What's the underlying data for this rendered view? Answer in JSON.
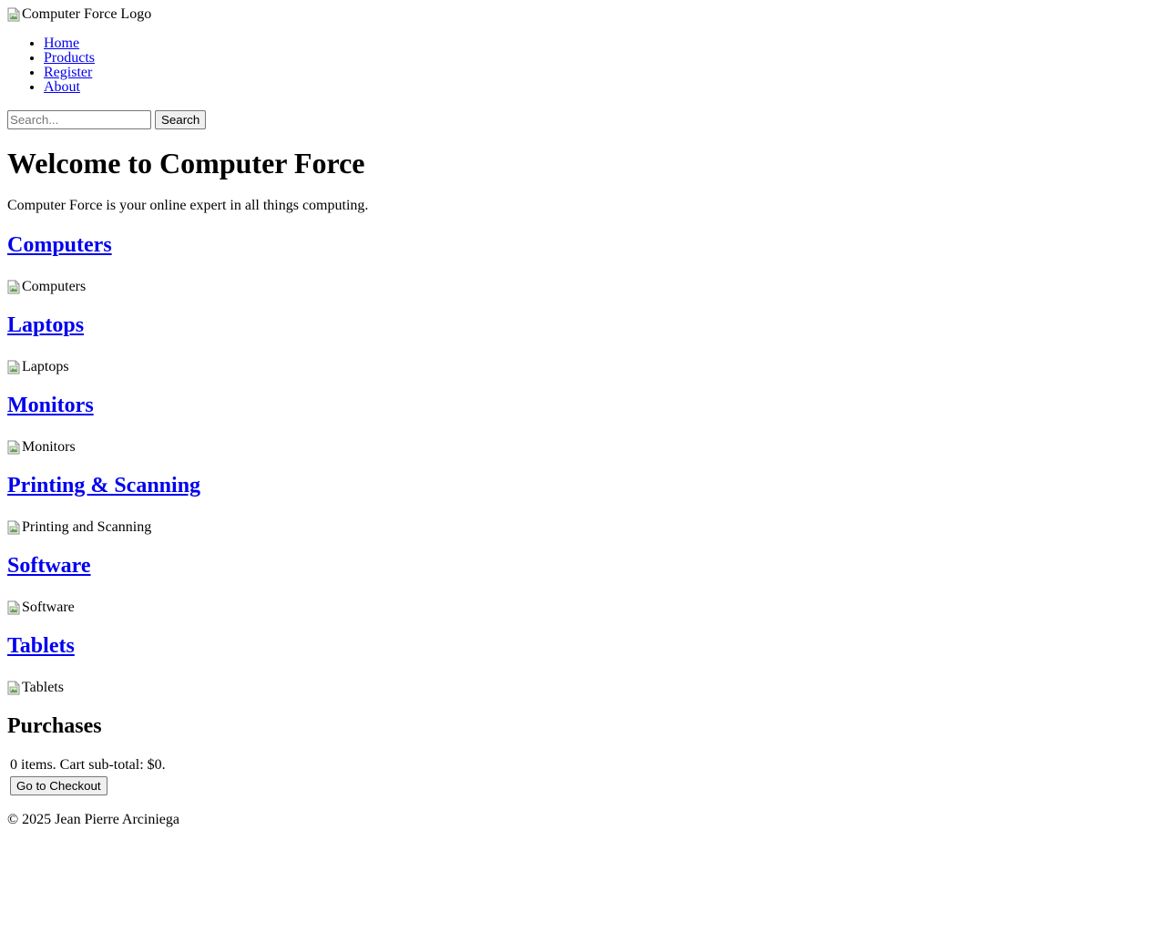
{
  "header": {
    "logo_alt": "Computer Force Logo"
  },
  "nav": {
    "items": [
      {
        "label": "Home"
      },
      {
        "label": "Products"
      },
      {
        "label": "Register"
      },
      {
        "label": "About"
      }
    ]
  },
  "search": {
    "placeholder": "Search...",
    "value": "",
    "button_label": "Search"
  },
  "main": {
    "title": "Welcome to Computer Force",
    "intro": "Computer Force is your online expert in all things computing.",
    "categories": [
      {
        "title": "Computers",
        "img_alt": "Computers"
      },
      {
        "title": "Laptops",
        "img_alt": "Laptops"
      },
      {
        "title": "Monitors",
        "img_alt": "Monitors"
      },
      {
        "title": "Printing & Scanning",
        "img_alt": "Printing and Scanning"
      },
      {
        "title": "Software",
        "img_alt": "Software"
      },
      {
        "title": "Tablets",
        "img_alt": "Tablets"
      }
    ]
  },
  "purchases": {
    "title": "Purchases",
    "summary": "0 items. Cart sub-total: $0.",
    "checkout_label": "Go to Checkout"
  },
  "footer": {
    "copyright": "© 2025 Jean Pierre Arciniega"
  },
  "colors": {
    "link": "#0000ee",
    "text": "#000000",
    "background": "#ffffff"
  }
}
